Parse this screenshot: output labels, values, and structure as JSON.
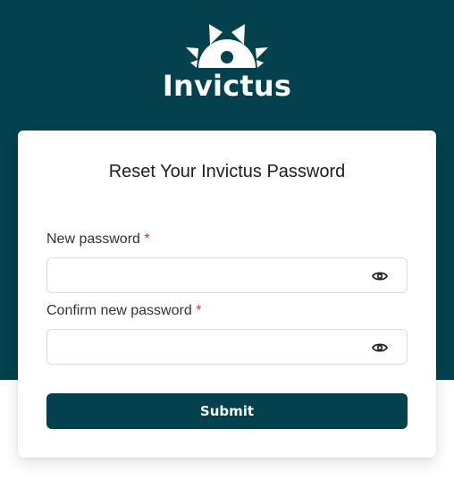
{
  "brand": {
    "name": "Invictus",
    "colors": {
      "primary": "#02414d",
      "required": "#d63a2f"
    }
  },
  "form": {
    "title": "Reset Your Invictus Password",
    "required_marker": "*",
    "fields": [
      {
        "label": "New password",
        "value": "",
        "icon": "eye-icon"
      },
      {
        "label": "Confirm new password",
        "value": "",
        "icon": "eye-icon"
      }
    ],
    "submit_label": "Submit"
  }
}
